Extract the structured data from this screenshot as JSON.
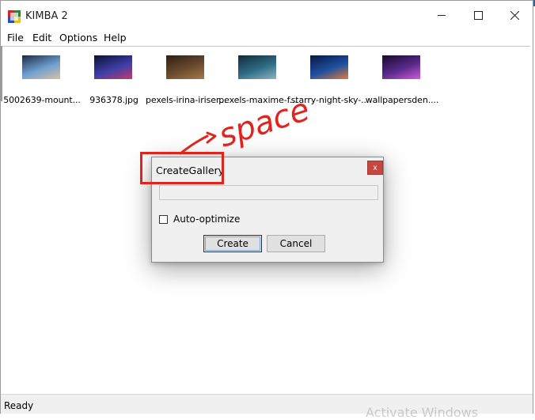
{
  "window": {
    "title": "KIMBA 2",
    "controls": [
      "minimize-icon",
      "maximize-icon",
      "close-icon"
    ]
  },
  "menu": {
    "items": [
      "File",
      "Edit",
      "Options",
      "Help"
    ]
  },
  "gallery": {
    "items": [
      {
        "caption": "5002639-mount...",
        "colors": [
          "#1c2a44",
          "#6fa0d0",
          "#d8c2a0"
        ]
      },
      {
        "caption": "936378.jpg",
        "colors": [
          "#0b1230",
          "#3d3ea8",
          "#c23b6b"
        ]
      },
      {
        "caption": "pexels-irina-iriser...",
        "colors": [
          "#2c2016",
          "#6b4a2e",
          "#a67b4c"
        ]
      },
      {
        "caption": "pexels-maxime-f...",
        "colors": [
          "#132a3a",
          "#2e6c85",
          "#8fb3c0"
        ]
      },
      {
        "caption": "starry-night-sky-...",
        "colors": [
          "#061840",
          "#1f4fa0",
          "#e07a3a"
        ]
      },
      {
        "caption": "wallpapersden....",
        "colors": [
          "#170a2e",
          "#5a2a8c",
          "#d05ad8"
        ]
      }
    ]
  },
  "status": {
    "text": "Ready"
  },
  "dialog": {
    "title": "CreateGallery",
    "close_label": "x",
    "input_value": "",
    "checkbox_label": "Auto-optimize",
    "checkbox_checked": false,
    "create_label": "Create",
    "cancel_label": "Cancel"
  },
  "annotation": {
    "text": "space",
    "color": "#e0231b"
  },
  "watermark": {
    "text": "Activate Windows"
  }
}
